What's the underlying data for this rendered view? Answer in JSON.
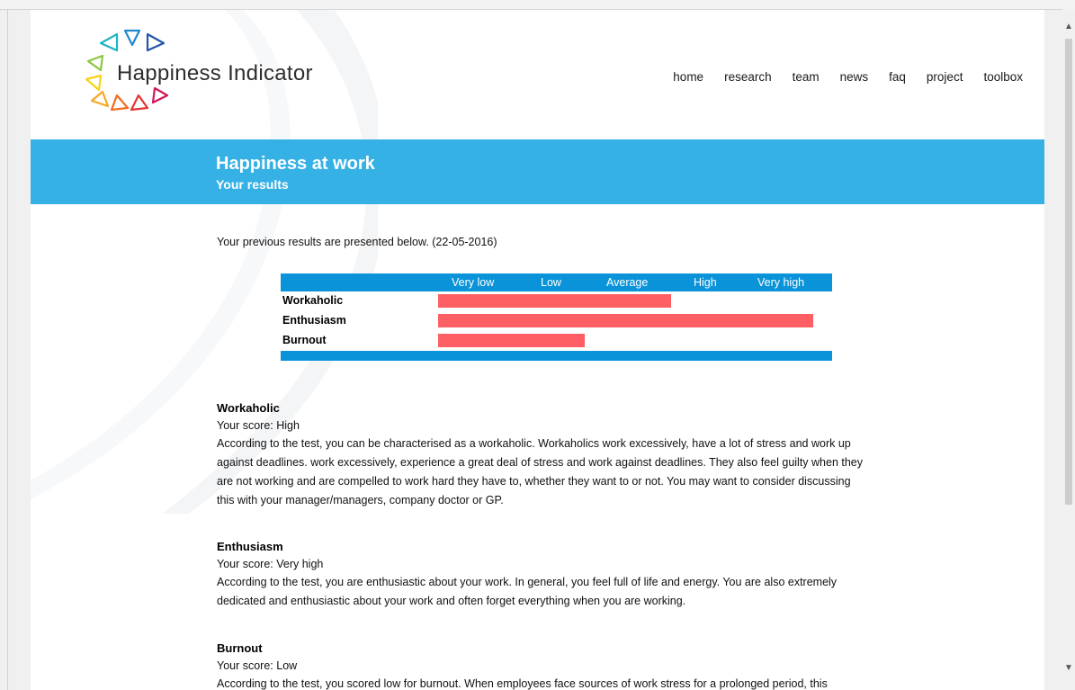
{
  "site": {
    "name": "Happiness Indicator"
  },
  "nav": [
    "home",
    "research",
    "team",
    "news",
    "faq",
    "project",
    "toolbox"
  ],
  "banner": {
    "title": "Happiness at work",
    "subtitle": "Your results"
  },
  "intro": "Your previous results are presented below. (22-05-2016)",
  "chart_data": {
    "type": "bar",
    "levels": [
      "Very low",
      "Low",
      "Average",
      "High",
      "Very high"
    ],
    "categories": [
      "Workaholic",
      "Enthusiasm",
      "Burnout"
    ],
    "values": [
      0.62,
      1.0,
      0.39
    ]
  },
  "sections": [
    {
      "title": "Workaholic",
      "score": "Your score: High",
      "text": "According to the test, you can be characterised as a workaholic. Workaholics work excessively, have a lot of stress and work up against deadlines. work excessively, experience a great deal of stress and work against deadlines. They also feel guilty when they are not working and are compelled to work hard  they have to, whether they want to or not. You may want to consider discussing this with your manager/managers, company doctor or GP."
    },
    {
      "title": "Enthusiasm",
      "score": "Your score: Very high",
      "text": "According to the test, you are enthusiastic about your work. In general, you feel full of life and energy. You are also extremely dedicated and enthusiastic about your work and often forget everything when you are working."
    },
    {
      "title": "Burnout",
      "score": "Your score: Low",
      "text": "According to the test, you scored low for burnout. When employees face sources of work stress for a prolonged period, this"
    }
  ],
  "colors": {
    "banner": "#35b1e6",
    "chart_band": "#0b93d9",
    "bar": "#fd5f64"
  }
}
